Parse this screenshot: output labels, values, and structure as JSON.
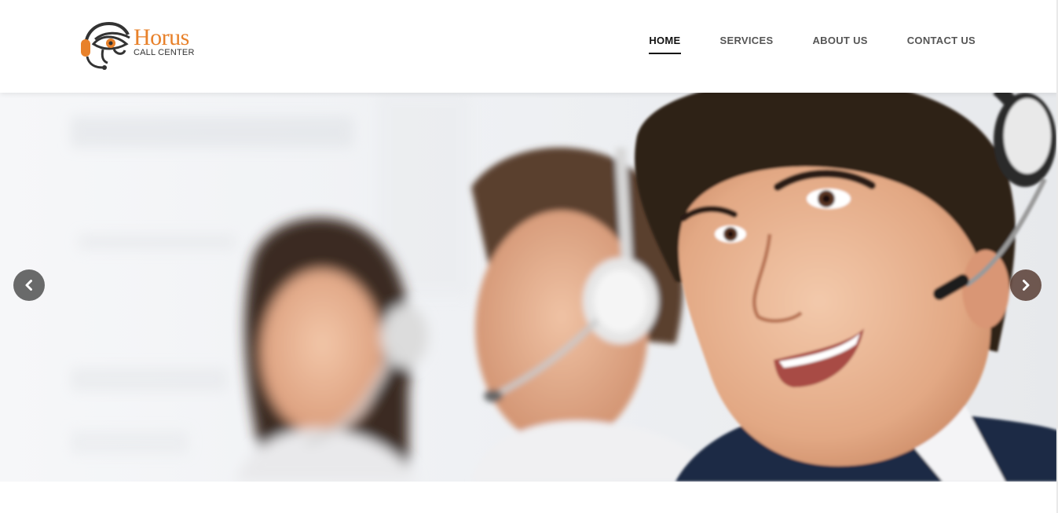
{
  "brand": {
    "name": "Horus",
    "tagline": "CALL CENTER",
    "logo_icon": "headset-eye-of-horus-icon",
    "accent_color": "#e8812a"
  },
  "nav": {
    "items": [
      {
        "label": "HOME",
        "active": true
      },
      {
        "label": "SERVICES",
        "active": false
      },
      {
        "label": "ABOUT US",
        "active": false
      },
      {
        "label": "CONTACT US",
        "active": false
      }
    ]
  },
  "slider": {
    "image": "call-center-agents-with-headsets",
    "prev_icon": "chevron-left-icon",
    "next_icon": "chevron-right-icon"
  }
}
